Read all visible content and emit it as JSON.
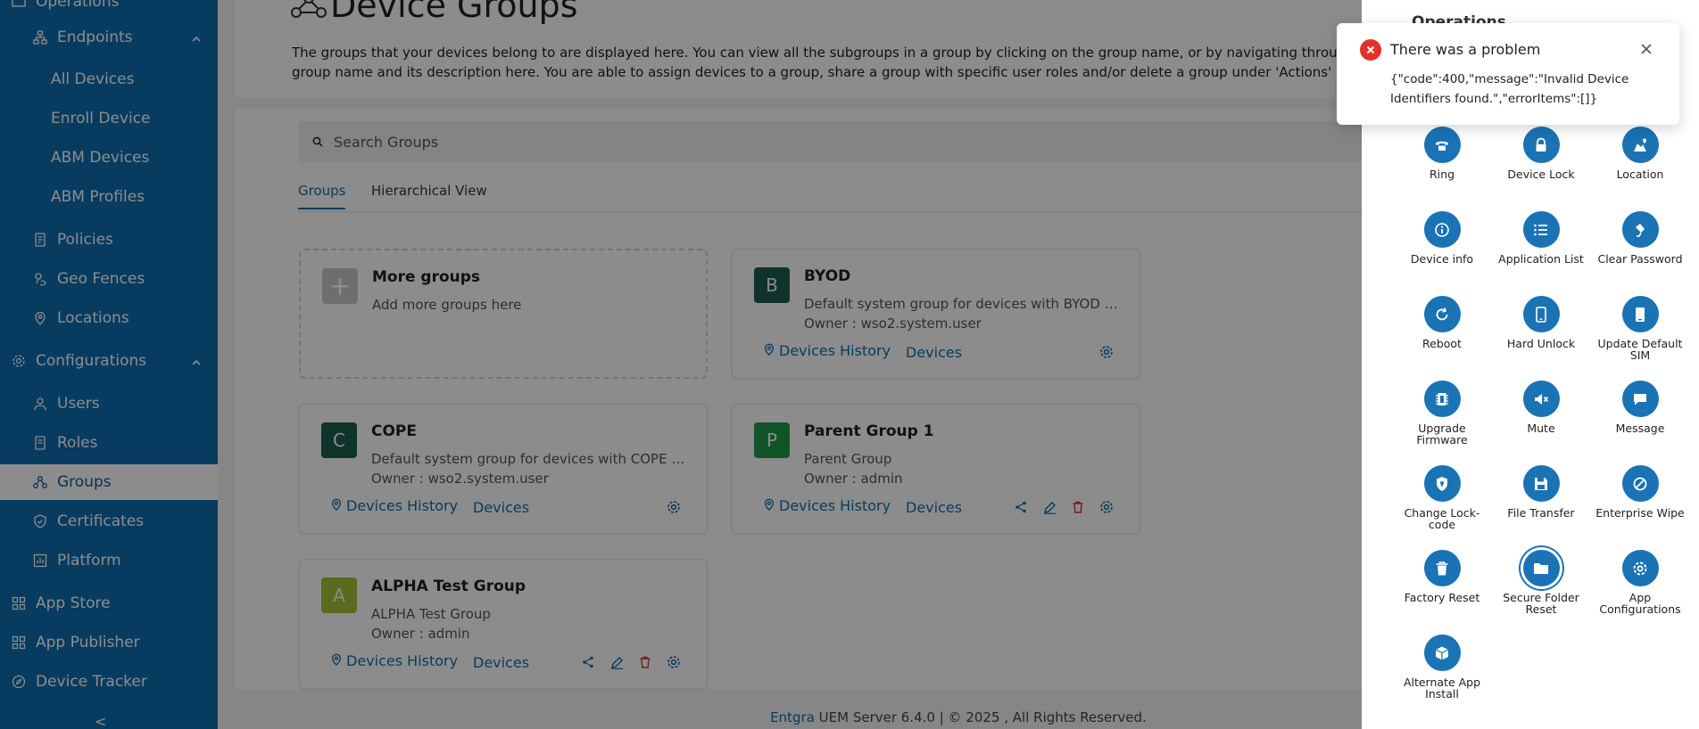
{
  "sidebar": {
    "top_partial_label": "Operations",
    "items": [
      {
        "label": "Endpoints"
      },
      {
        "label": "All Devices"
      },
      {
        "label": "Enroll Device"
      },
      {
        "label": "ABM Devices"
      },
      {
        "label": "ABM Profiles"
      },
      {
        "label": "Policies"
      },
      {
        "label": "Geo Fences"
      },
      {
        "label": "Locations"
      },
      {
        "label": "Configurations"
      },
      {
        "label": "Users"
      },
      {
        "label": "Roles"
      },
      {
        "label": "Groups"
      },
      {
        "label": "Certificates"
      },
      {
        "label": "Platform"
      },
      {
        "label": "App Store"
      },
      {
        "label": "App Publisher"
      },
      {
        "label": "Device Tracker"
      }
    ],
    "collapse_label": "<"
  },
  "main": {
    "title": "Device Groups",
    "description": "The groups that your devices belong to are displayed here. You can view all the subgroups in a group by clicking on the group name, or by navigating through the hierarchical view. You can edit the group name and its description here. You are able to assign devices to a group, share a group with specific user roles and/or delete a group under 'Actions'",
    "search_placeholder": "Search Groups",
    "tabs": [
      {
        "label": "Groups"
      },
      {
        "label": "Hierarchical View"
      }
    ],
    "more_groups": {
      "title": "More groups",
      "subtitle": "Add more groups here",
      "icon": "+"
    },
    "cards": [
      {
        "initial": "B",
        "name": "BYOD",
        "desc": "Default system group for devices with BYOD owne...",
        "owner": "Owner : wso2.system.user",
        "history": "Devices History",
        "devices": "Devices",
        "color": "#1e5d4f"
      },
      {
        "initial": "C",
        "name": "COPE",
        "desc": "Default system group for devices with COPE owne...",
        "owner": "Owner : wso2.system.user",
        "history": "Devices History",
        "devices": "Devices",
        "color": "#1e5d4f"
      },
      {
        "initial": "P",
        "name": "Parent Group 1",
        "desc": "Parent Group",
        "owner": "Owner : admin",
        "history": "Devices History",
        "devices": "Devices",
        "color": "#1f9a4a"
      },
      {
        "initial": "A",
        "name": "ALPHA Test Group",
        "desc": "ALPHA Test Group",
        "owner": "Owner : admin",
        "history": "Devices History",
        "devices": "Devices",
        "color": "#a3c43a"
      }
    ]
  },
  "footer": {
    "brand": "Entgra",
    "text": " UEM Server 6.4.0 | © 2025 , All Rights Reserved."
  },
  "drawer": {
    "title": "Operations",
    "operations": [
      {
        "label": "Ring",
        "icon": "phone-icon"
      },
      {
        "label": "Device Lock",
        "icon": "lock-icon"
      },
      {
        "label": "Location",
        "icon": "location-icon"
      },
      {
        "label": "Device info",
        "icon": "info-icon"
      },
      {
        "label": "Application List",
        "icon": "list-icon"
      },
      {
        "label": "Clear Password",
        "icon": "eraser-icon"
      },
      {
        "label": "Reboot",
        "icon": "reboot-icon"
      },
      {
        "label": "Hard Unlock",
        "icon": "phone-unlock-icon"
      },
      {
        "label": "Update Default SIM",
        "icon": "sim-icon"
      },
      {
        "label": "Upgrade Firmware",
        "icon": "chip-icon"
      },
      {
        "label": "Mute",
        "icon": "mute-icon"
      },
      {
        "label": "Message",
        "icon": "message-icon"
      },
      {
        "label": "Change Lock-code",
        "icon": "shield-icon"
      },
      {
        "label": "File Transfer",
        "icon": "save-icon"
      },
      {
        "label": "Enterprise Wipe",
        "icon": "block-icon"
      },
      {
        "label": "Factory Reset",
        "icon": "trash-icon"
      },
      {
        "label": "Secure Folder Reset",
        "icon": "folder-icon"
      },
      {
        "label": "App Configurations",
        "icon": "gear-icon"
      },
      {
        "label": "Alternate App Install",
        "icon": "box-icon"
      }
    ]
  },
  "toast": {
    "title": "There was a problem",
    "message": "{\"code\":400,\"message\":\"Invalid Device Identifiers found.\",\"errorItems\":[]}"
  },
  "colors": {
    "primary": "#0e6eaf",
    "danger": "#e5312b"
  }
}
